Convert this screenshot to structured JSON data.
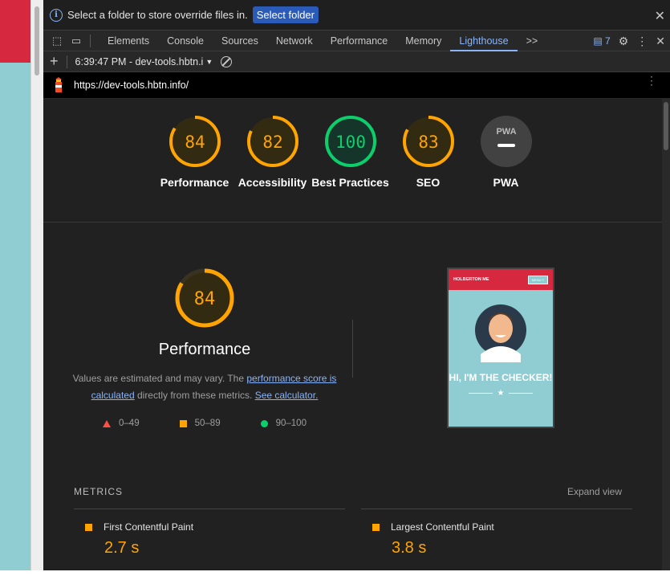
{
  "infobar": {
    "message": "Select a folder to store override files in.",
    "button": "Select folder"
  },
  "tabs": [
    "Elements",
    "Console",
    "Sources",
    "Network",
    "Performance",
    "Memory",
    "Lighthouse"
  ],
  "tabs_more": ">>",
  "issues_count": "7",
  "report": {
    "timestamp": "6:39:47 PM - dev-tools.hbtn.i",
    "url": "https://dev-tools.hbtn.info/"
  },
  "gauges": [
    {
      "score": "84",
      "label": "Performance",
      "color": "#ffa400"
    },
    {
      "score": "82",
      "label": "Accessibility",
      "color": "#ffa400"
    },
    {
      "score": "100",
      "label": "Best Practices",
      "color": "#0cce6b"
    },
    {
      "score": "83",
      "label": "SEO",
      "color": "#ffa400"
    },
    {
      "score": "",
      "label": "PWA",
      "color": "#9e9e9e",
      "badge": "PWA"
    }
  ],
  "performance": {
    "score": "84",
    "title": "Performance",
    "desc_prefix": "Values are estimated and may vary. The ",
    "link1": "performance score is calculated",
    "desc_mid": " directly from these metrics. ",
    "link2": "See calculator.",
    "legend": [
      "0–49",
      "50–89",
      "90–100"
    ]
  },
  "screenshot": {
    "brand": "HOLBERTON ME",
    "menu": "MENU ≡",
    "hero": "HI, I'M THE CHECKER!"
  },
  "metrics": {
    "heading": "METRICS",
    "expand": "Expand view",
    "items": [
      {
        "name": "First Contentful Paint",
        "value": "2.7 s"
      },
      {
        "name": "Largest Contentful Paint",
        "value": "3.8 s"
      }
    ]
  }
}
